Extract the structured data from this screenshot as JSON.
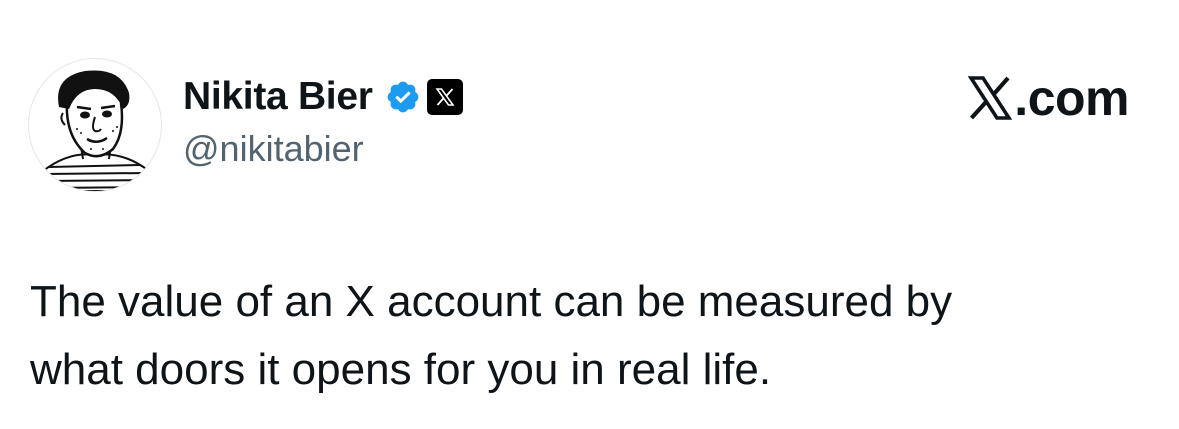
{
  "author": {
    "display_name": "Nikita Bier",
    "handle": "@nikitabier",
    "avatar": "avatar-sketch",
    "verified_icon": "verified-badge-icon",
    "affiliate_icon": "x-logo-badge-icon"
  },
  "brand": {
    "logo_icon": "x-logo-icon",
    "text": ".com"
  },
  "tweet": {
    "lines": [
      "The value of an X account can be measured by",
      "what doors it opens for you in real life."
    ]
  },
  "colors": {
    "text": "#0f1419",
    "secondary_text": "#536471",
    "verified_blue": "#1d9bf0",
    "background": "#ffffff"
  }
}
